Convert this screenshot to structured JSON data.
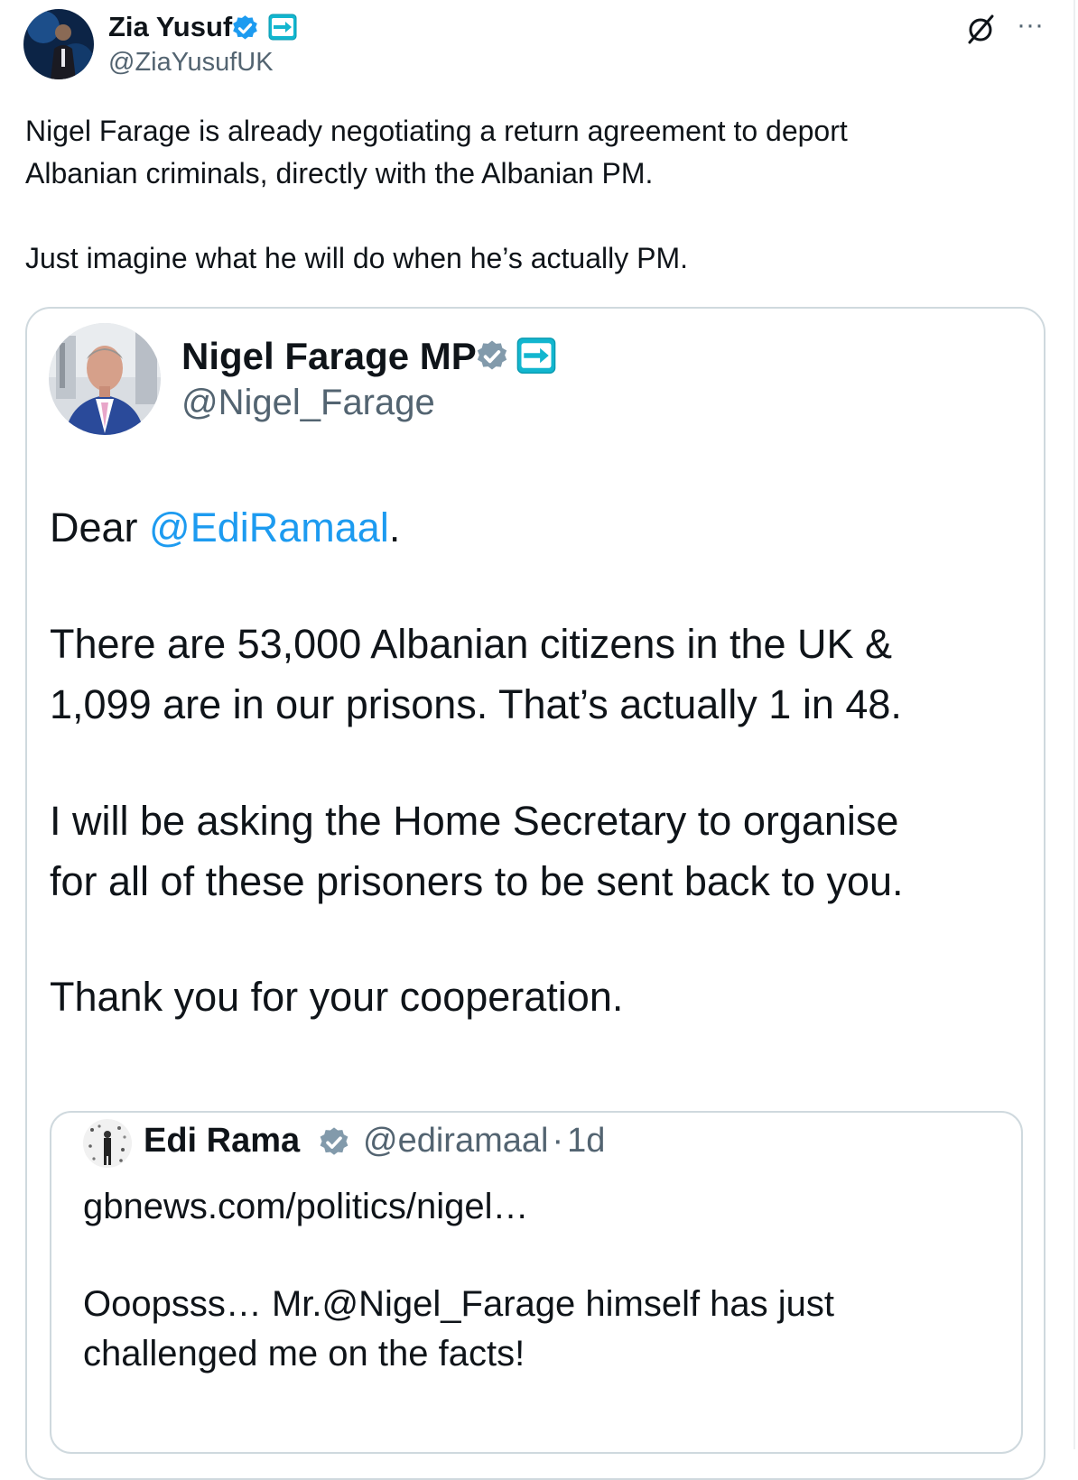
{
  "author": {
    "name": "Zia Yusuf",
    "handle": "@ZiaYusufUK",
    "verified_color": "#1d9bf0",
    "badge": "reform-uk-badge"
  },
  "tweet": {
    "line1": "Nigel Farage is already negotiating a return agreement to deport",
    "line2": "Albanian criminals, directly with the Albanian PM.",
    "line3": "Just imagine what he will do when he’s actually PM."
  },
  "actions": {
    "grok_icon": "grok-icon",
    "more_icon": "more-icon",
    "more_label": "···"
  },
  "quoted": {
    "name": "Nigel Farage MP",
    "handle": "@Nigel_Farage",
    "verified_color": "#829aab",
    "badge": "reform-uk-badge",
    "dear_prefix": "Dear ",
    "dear_mention": "@EdiRamaal",
    "dear_suffix": ".",
    "para1_line1": "There are 53,000 Albanian citizens in the UK &",
    "para1_line2": "1,099 are in our prisons. That’s actually 1 in 48.",
    "para2_line1": "I will be asking the Home Secretary to organise",
    "para2_line2": "for all of these prisoners to be sent back to you.",
    "para3": "Thank you for your cooperation."
  },
  "nested": {
    "name": "Edi Rama",
    "handle": "@ediramaal",
    "separator": "·",
    "time": "1d",
    "verified_color": "#829aab",
    "link": "gbnews.com/politics/nigel…",
    "text_line1": "Ooopsss… Mr.@Nigel_Farage himself has just",
    "text_line2": "challenged me on the facts!"
  },
  "colors": {
    "accent": "#1d9bf0",
    "border": "#cfd9de",
    "muted": "#536471",
    "reform": "#12b6cf"
  }
}
